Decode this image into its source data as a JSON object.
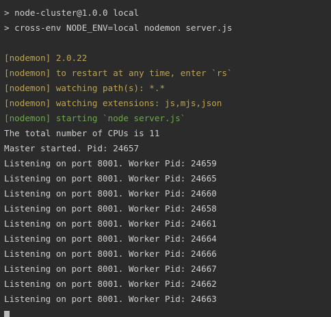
{
  "colors": {
    "background": "#2b2b2b",
    "default_text": "#cdcfd2",
    "nodemon_yellow": "#bba45a",
    "nodemon_green": "#6fa64f"
  },
  "terminal": {
    "lines": [
      {
        "text": "> node-cluster@1.0.0 local",
        "color": "#cdcfd2"
      },
      {
        "text": "> cross-env NODE_ENV=local nodemon server.js",
        "color": "#cdcfd2"
      },
      {
        "text": "",
        "color": "#cdcfd2"
      },
      {
        "text": "[nodemon] 2.0.22",
        "color": "#bba45a"
      },
      {
        "text": "[nodemon] to restart at any time, enter `rs`",
        "color": "#bba45a"
      },
      {
        "text": "[nodemon] watching path(s): *.*",
        "color": "#bba45a"
      },
      {
        "text": "[nodemon] watching extensions: js,mjs,json",
        "color": "#bba45a"
      },
      {
        "text": "[nodemon] starting `node server.js`",
        "color": "#6fa64f"
      },
      {
        "text": "The total number of CPUs is 11",
        "color": "#cdcfd2"
      },
      {
        "text": "Master started. Pid: 24657",
        "color": "#cdcfd2"
      },
      {
        "text": "Listening on port 8001. Worker Pid: 24659",
        "color": "#cdcfd2"
      },
      {
        "text": "Listening on port 8001. Worker Pid: 24665",
        "color": "#cdcfd2"
      },
      {
        "text": "Listening on port 8001. Worker Pid: 24660",
        "color": "#cdcfd2"
      },
      {
        "text": "Listening on port 8001. Worker Pid: 24658",
        "color": "#cdcfd2"
      },
      {
        "text": "Listening on port 8001. Worker Pid: 24661",
        "color": "#cdcfd2"
      },
      {
        "text": "Listening on port 8001. Worker Pid: 24664",
        "color": "#cdcfd2"
      },
      {
        "text": "Listening on port 8001. Worker Pid: 24666",
        "color": "#cdcfd2"
      },
      {
        "text": "Listening on port 8001. Worker Pid: 24667",
        "color": "#cdcfd2"
      },
      {
        "text": "Listening on port 8001. Worker Pid: 24662",
        "color": "#cdcfd2"
      },
      {
        "text": "Listening on port 8001. Worker Pid: 24663",
        "color": "#cdcfd2"
      }
    ]
  }
}
